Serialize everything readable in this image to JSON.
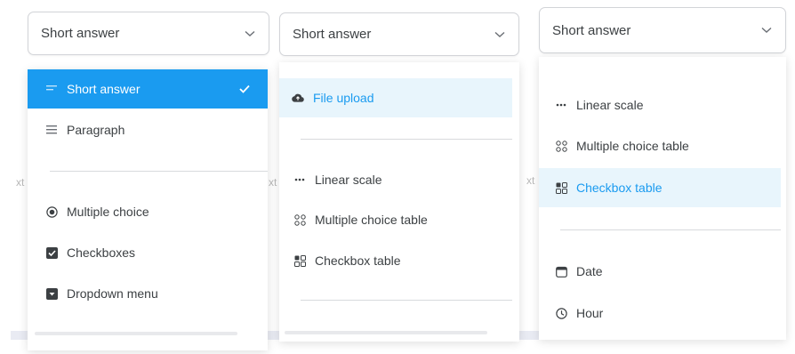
{
  "selects": [
    {
      "value": "Short answer"
    },
    {
      "value": "Short answer"
    },
    {
      "value": "Short answer"
    }
  ],
  "menu1": {
    "items": [
      {
        "label": "Short answer",
        "icon": "short-text-icon",
        "state": "selected"
      },
      {
        "label": "Paragraph",
        "icon": "paragraph-icon"
      },
      {
        "label": "Multiple choice",
        "icon": "radio-icon"
      },
      {
        "label": "Checkboxes",
        "icon": "checkbox-icon"
      },
      {
        "label": "Dropdown menu",
        "icon": "dropdown-icon"
      }
    ]
  },
  "menu2": {
    "items": [
      {
        "label": "File upload",
        "icon": "cloud-upload-icon",
        "state": "hover"
      },
      {
        "label": "Linear scale",
        "icon": "ellipsis-icon"
      },
      {
        "label": "Multiple choice table",
        "icon": "grid-icon"
      },
      {
        "label": "Checkbox table",
        "icon": "checkbox-grid-icon"
      }
    ]
  },
  "menu3": {
    "items": [
      {
        "label": "Linear scale",
        "icon": "ellipsis-icon"
      },
      {
        "label": "Multiple choice table",
        "icon": "grid-icon"
      },
      {
        "label": "Checkbox table",
        "icon": "checkbox-grid-icon",
        "state": "hover"
      },
      {
        "label": "Date",
        "icon": "calendar-icon"
      },
      {
        "label": "Hour",
        "icon": "clock-icon"
      }
    ]
  },
  "background": {
    "fragment": "xt"
  },
  "colors": {
    "accent": "#1a9bf0",
    "hover_bg": "#e8f5fc",
    "text": "#3c4043",
    "border": "#d2d4d8"
  }
}
